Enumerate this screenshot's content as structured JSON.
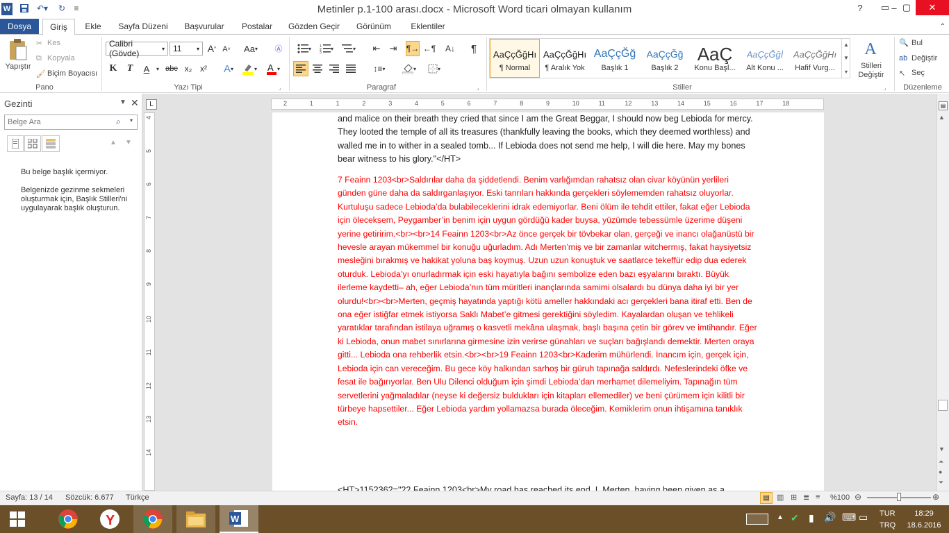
{
  "window": {
    "title": "Metinler p.1-100 arası.docx  -  Microsoft Word ticari olmayan kullanım",
    "controls": [
      "?",
      "▭",
      "–",
      "▢",
      "✕"
    ]
  },
  "tabs": [
    {
      "label": "Dosya"
    },
    {
      "label": "Giriş"
    },
    {
      "label": "Ekle"
    },
    {
      "label": "Sayfa Düzeni"
    },
    {
      "label": "Başvurular"
    },
    {
      "label": "Postalar"
    },
    {
      "label": "Gözden Geçir"
    },
    {
      "label": "Görünüm"
    },
    {
      "label": "Eklentiler"
    }
  ],
  "ribbon": {
    "clipboard": {
      "paste": "Yapıştır",
      "cut": "Kes",
      "copy": "Kopyala",
      "format_painter": "Biçim Boyacısı",
      "label": "Pano"
    },
    "font": {
      "name": "Calibri (Gövde)",
      "size": "11",
      "label": "Yazı Tipi",
      "grow": "A",
      "shrink": "A",
      "case": "Aa",
      "bold": "K",
      "italic": "T",
      "underline": "A",
      "strike": "abc",
      "sub": "x₂",
      "sup": "x²"
    },
    "paragraph": {
      "label": "Paragraf",
      "pilcrow": "¶"
    },
    "styles": {
      "label": "Stiller",
      "items": [
        {
          "preview": "AaÇçĞğHı",
          "name": "¶ Normal"
        },
        {
          "preview": "AaÇçĞğHı",
          "name": "¶ Aralık Yok"
        },
        {
          "preview": "AaÇçĞğ",
          "name": "Başlık 1"
        },
        {
          "preview": "AaÇçĞğ",
          "name": "Başlık 2"
        },
        {
          "preview": "AaÇ",
          "name": "Konu Başl..."
        },
        {
          "preview": "AaÇçĞğİ",
          "name": "Alt Konu ..."
        },
        {
          "preview": "AaÇçĞğHı",
          "name": "Hafif Vurg..."
        }
      ],
      "change": "Stilleri Değiştir"
    },
    "editing": {
      "label": "Düzenleme",
      "find": "Bul",
      "replace": "Değiştir",
      "select": "Seç"
    }
  },
  "nav": {
    "title": "Gezinti",
    "search_placeholder": "Belge Ara",
    "msg1": "Bu belge başlık içermiyor.",
    "msg2": "Belgenizde gezinme sekmeleri oluşturmak için, Başlık Stilleri'ni uygulayarak başlık oluşturun."
  },
  "document": {
    "para_black": "and malice on their breath they cried that since I am the Great Beggar, I should now beg Lebioda for mercy. They looted the temple of all its treasures (thankfully leaving the books, which they deemed worthless) and walled me in to wither in a sealed tomb... If Lebioda does not send me help, I will die here. May my bones bear witness to his glory.\"</HT>",
    "para_red": " 7 Feainn 1203<br>Saldırılar  daha da şiddetlendi. Benim varlığımdan rahatsız olan civar köyünün yerlileri günden güne daha da saldırganlaşıyor. Eski tanrıları hakkında gerçekleri söylememden rahatsız oluyorlar. Kurtuluşu sadece Lebioda’da bulabileceklerini idrak edemiyorlar. Beni ölüm ile tehdit ettiler, fakat eğer Lebioda için öleceksem, Peygamber’in benim için uygun gördüğü kader buysa, yüzümde tebessümle üzerime düşeni yerine getiririm.<br><br>14 Feainn 1203<br>Az önce gerçek bir tövbekar olan, gerçeği ve inancı olağanüstü bir hevesle arayan mükemmel bir konuğu uğurladım. Adı Merten’miş ve bir zamanlar witchermış, fakat haysiyetsiz mesleğini bırakmış ve hakikat yoluna baş koymuş. Uzun uzun konuştuk ve saatlarce tekeffür edip dua ederek oturduk. Lebioda’yı onurladırmak için eski hayatıyla bağını sembolize eden bazı eşyalarını bıraktı. Büyük ilerleme kaydetti– ah, eğer Lebioda’nın tüm müritleri inançlarında samimi olsalardı bu dünya daha iyi bir yer olurdu!<br><br>Merten, geçmiş hayatında yaptığı kötü ameller hakkındaki acı gerçekleri bana itiraf etti. Ben de ona eğer istiğfar etmek istiyorsa Saklı Mabet’e gitmesi gerektiğini söyledim. Kayalardan oluşan ve tehlikeli yaratıklar tarafından istilaya uğramış o kasvetli mekâna ulaşmak, başlı başına çetin bir görev ve imtihandır.  Eğer ki Lebioda, onun mabet sınırlarına girmesine izin verirse günahları ve suçları bağışlandı demektir. Merten oraya gitti... Lebioda ona rehberlik etsin.<br><br>19 Feainn 1203<br>Kaderim mühürlendi. İnancım için, gerçek için,  Lebioda için can vereceğim. Bu gece köy halkından sarhoş bir güruh tapınağa saldırdı.  Nefeslerindeki öfke ve fesat ile bağırıyorlar. Ben Ulu Dilenci olduğum için şimdi Lebioda’dan merhamet dilemeliyim. Tapınağın tüm servetlerini yağmaladılar (neyse ki değersiz buldukları için kitapları ellemediler) ve beni çürümem için kilitli bir türbeye hapsettiler... Eğer Lebioda yardım yollamazsa burada öleceğim. Kemiklerim onun ihtişamına tanıklık etsin.",
    "para_bottom": "<HT>1152362=\"22 Feainn 1203<br>My road has reached its end. I, Merten, having been given as a"
  },
  "ruler": {
    "ticks": [
      "2",
      "1",
      "1",
      "2",
      "3",
      "4",
      "5",
      "6",
      "7",
      "8",
      "9",
      "10",
      "11",
      "12",
      "13",
      "14",
      "15",
      "16",
      "17",
      "18"
    ]
  },
  "vruler": {
    "ticks": [
      "4",
      "5",
      "6",
      "7",
      "8",
      "9",
      "10",
      "11",
      "12",
      "13",
      "14"
    ]
  },
  "status": {
    "page": "Sayfa: 13 / 14",
    "words": "Sözcük: 6.677",
    "lang": "Türkçe",
    "zoom": "%100"
  },
  "taskbar": {
    "lang": "TUR",
    "layout": "TRQ",
    "time": "18:29",
    "date": "18.6.2016"
  },
  "colors": {
    "accent": "#2b579a",
    "red_text": "#ff0000",
    "taskbar": "#6a4f29"
  }
}
